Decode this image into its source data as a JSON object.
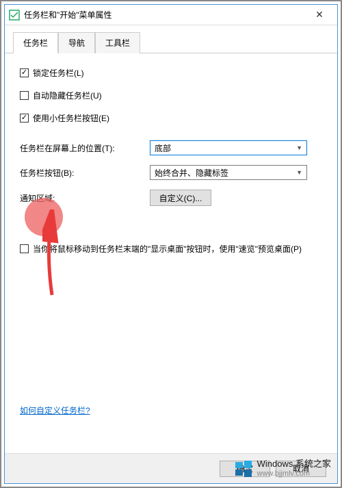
{
  "window": {
    "title": "任务栏和\"开始\"菜单属性",
    "close_icon": "✕"
  },
  "tabs": {
    "items": [
      {
        "label": "任务栏",
        "active": true
      },
      {
        "label": "导航",
        "active": false
      },
      {
        "label": "工具栏",
        "active": false
      }
    ]
  },
  "checkboxes": {
    "lock": {
      "label": "锁定任务栏(L)",
      "checked": true
    },
    "autohide": {
      "label": "自动隐藏任务栏(U)",
      "checked": false
    },
    "small": {
      "label": "使用小任务栏按钮(E)",
      "checked": true
    },
    "peek": {
      "label": "当你将鼠标移动到任务栏末端的\"显示桌面\"按钮时，使用\"速览\"预览桌面(P)",
      "checked": false
    }
  },
  "form": {
    "position": {
      "label": "任务栏在屏幕上的位置(T):",
      "value": "底部"
    },
    "buttons": {
      "label": "任务栏按钮(B):",
      "value": "始终合并、隐藏标签"
    },
    "notify": {
      "label": "通知区域:",
      "button": "自定义(C)..."
    }
  },
  "link": {
    "text": "如何自定义任务栏?"
  },
  "footer": {
    "ok": "确定",
    "cancel": "取消"
  },
  "watermark": {
    "line1": "Windows 系统之家",
    "line2": "www.bjjmlv.com"
  }
}
